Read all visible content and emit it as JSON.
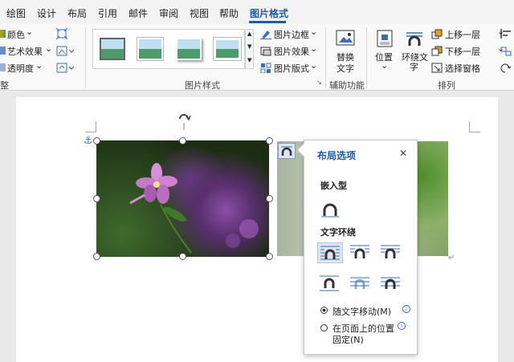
{
  "tabs": [
    "绘图",
    "设计",
    "布局",
    "引用",
    "邮件",
    "审阅",
    "视图",
    "帮助",
    "图片格式"
  ],
  "ribbon": {
    "adjust": {
      "color": "颜色",
      "art_effects": "艺术效果",
      "transparency": "透明度",
      "group_label": "整"
    },
    "styles_group_label": "图片样式",
    "border": "图片边框",
    "effects": "图片效果",
    "layout": "图片版式",
    "alt_text_line1": "替换",
    "alt_text_line2": "文字",
    "accessibility_label": "辅助功能",
    "position": "位置",
    "wrap_text_line1": "环绕文",
    "wrap_text_line2": "字",
    "bring_forward": "上移一层",
    "send_backward": "下移一层",
    "selection_pane": "选择窗格",
    "arrange_label": "排列",
    "dropdown_arrow": "⌄"
  },
  "layout_popup": {
    "title": "布局选项",
    "close": "✕",
    "inline_heading": "嵌入型",
    "wrap_heading": "文字环绕",
    "move_with_text": "随文字移动(M)",
    "fix_position_line1": "在页面上的位置",
    "fix_position_line2": "固定(N)",
    "info": "i"
  },
  "colors": {
    "accent": "#1e5aa8",
    "selected_tab": "#1e5aa8"
  }
}
